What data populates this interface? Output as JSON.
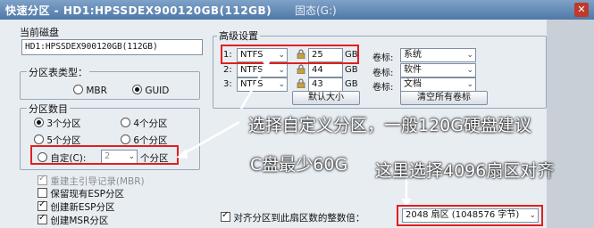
{
  "window": {
    "title": "快速分区 - HD1:HPSSDEX900120GB(112GB)",
    "background_title": "固态(G:)",
    "close_glyph": "✕"
  },
  "current_disk": {
    "label": "当前磁盘",
    "value": "HD1:HPSSDEX900120GB(112GB)"
  },
  "partition_table": {
    "label": "分区表类型：",
    "options": [
      "MBR",
      "GUID"
    ],
    "selected": "GUID"
  },
  "partition_count": {
    "label": "分区数目",
    "options": [
      "3个分区",
      "4个分区",
      "5个分区",
      "6个分区"
    ],
    "selected": "3个分区",
    "custom_label": "自定(C):",
    "custom_value": "2",
    "custom_suffix": "个分区"
  },
  "checkboxes": [
    {
      "label": "重建主引导记录(MBR)",
      "checked": true,
      "disabled": true
    },
    {
      "label": "保留现有ESP分区",
      "checked": false,
      "disabled": false
    },
    {
      "label": "创建新ESP分区",
      "checked": true,
      "disabled": false
    },
    {
      "label": "创建MSR分区",
      "checked": true,
      "disabled": false
    }
  ],
  "advanced": {
    "label": "高级设置",
    "rows": [
      {
        "num": "1:",
        "fs": "NTFS",
        "size": "25",
        "unit": "GB",
        "vol_label_text": "卷标:",
        "vol_label": "系统"
      },
      {
        "num": "2:",
        "fs": "NTFS",
        "size": "44",
        "unit": "GB",
        "vol_label_text": "卷标:",
        "vol_label": "软件"
      },
      {
        "num": "3:",
        "fs": "NTFS",
        "size": "43",
        "unit": "GB",
        "vol_label_text": "卷标:",
        "vol_label": "文档"
      }
    ],
    "default_size_button": "默认大小",
    "clear_labels_button": "清空所有卷标"
  },
  "align": {
    "label": "对齐分区到此扇区数的整数倍：",
    "checked": true,
    "value": "2048 扇区 (1048576 字节)"
  },
  "annotations": {
    "line1": "选择自定义分区，一般120G硬盘建议",
    "line2": "C盘最少60G",
    "line3": "这里选择4096扇区对齐"
  },
  "colors": {
    "annotation_box": "#e02020",
    "arrow": "#ffffff"
  }
}
